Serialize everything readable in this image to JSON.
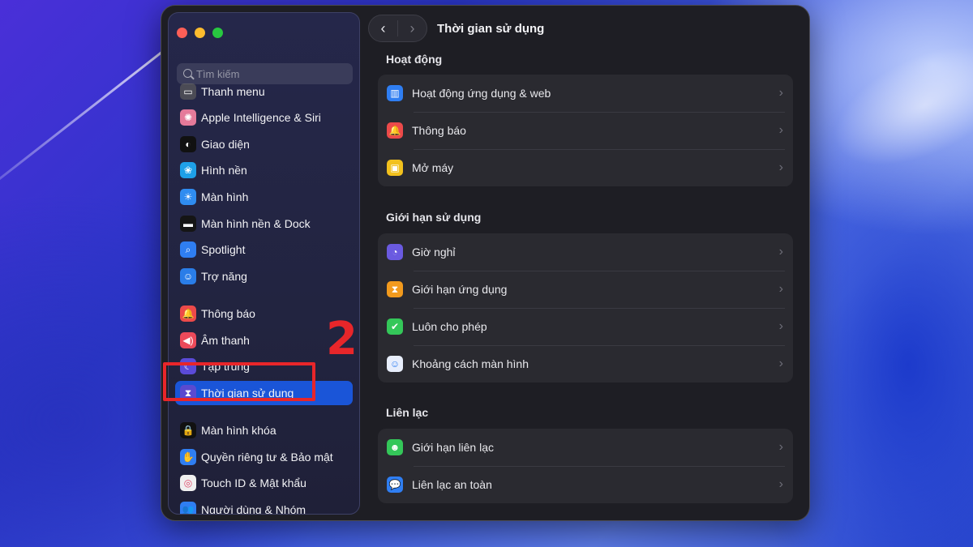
{
  "window_title": "Thời gian sử dụng",
  "search": {
    "placeholder": "Tìm kiếm"
  },
  "sidebar": {
    "items": [
      {
        "label": "Thanh menu",
        "icon": "menubar-icon",
        "color": "#4b4b55",
        "glyph": "▭"
      },
      {
        "label": "Apple Intelligence & Siri",
        "icon": "apple-intelligence-icon",
        "color": "#e57a9a",
        "glyph": "✺"
      },
      {
        "label": "Giao diện",
        "icon": "appearance-icon",
        "color": "#111111",
        "glyph": "◐"
      },
      {
        "label": "Hình nền",
        "icon": "wallpaper-icon",
        "color": "#1ea0e8",
        "glyph": "❀"
      },
      {
        "label": "Màn hình",
        "icon": "display-icon",
        "color": "#2f8cf0",
        "glyph": "☀"
      },
      {
        "label": "Màn hình nền & Dock",
        "icon": "desktop-dock-icon",
        "color": "#151515",
        "glyph": "▬"
      },
      {
        "label": "Spotlight",
        "icon": "spotlight-icon",
        "color": "#2f7ef2",
        "glyph": "⌕"
      },
      {
        "label": "Trợ năng",
        "icon": "accessibility-icon",
        "color": "#2a7de8",
        "glyph": "☺"
      },
      {
        "label": "Thông báo",
        "icon": "notifications-icon",
        "color": "#ec4a4a",
        "glyph": "🔔"
      },
      {
        "label": "Âm thanh",
        "icon": "sound-icon",
        "color": "#ec4a5a",
        "glyph": "◀)"
      },
      {
        "label": "Tập trung",
        "icon": "focus-icon",
        "color": "#5b4ad8",
        "glyph": "☾"
      },
      {
        "label": "Thời gian sử dụng",
        "icon": "screen-time-icon",
        "color": "#5a4ad0",
        "glyph": "⧗",
        "active": true
      },
      {
        "label": "Màn hình khóa",
        "icon": "lock-screen-icon",
        "color": "#111111",
        "glyph": "🔒"
      },
      {
        "label": "Quyền riêng tư & Bảo mật",
        "icon": "privacy-hand-icon",
        "color": "#2f7ef2",
        "glyph": "✋"
      },
      {
        "label": "Touch ID & Mật khẩu",
        "icon": "touch-id-icon",
        "color": "#f0f0f0",
        "glyph": "◎"
      },
      {
        "label": "Người dùng & Nhóm",
        "icon": "users-groups-icon",
        "color": "#2f7ef2",
        "glyph": "👥"
      }
    ]
  },
  "annotation": {
    "step": "2",
    "color": "#e8262a"
  },
  "sections": [
    {
      "title": "Hoạt động",
      "rows": [
        {
          "label": "Hoạt động ứng dụng & web",
          "icon": "app-activity-icon",
          "color": "#2f7ef2",
          "glyph": "▥"
        },
        {
          "label": "Thông báo",
          "icon": "notification-bell-icon",
          "color": "#ec4a4a",
          "glyph": "🔔"
        },
        {
          "label": "Mở máy",
          "icon": "pickups-icon",
          "color": "#f2c11d",
          "glyph": "▣"
        }
      ]
    },
    {
      "title": "Giới hạn sử dụng",
      "rows": [
        {
          "label": "Giờ nghỉ",
          "icon": "downtime-icon",
          "color": "#6a5ae0",
          "glyph": "◔"
        },
        {
          "label": "Giới hạn ứng dụng",
          "icon": "app-limits-icon",
          "color": "#f29a1d",
          "glyph": "⧗"
        },
        {
          "label": "Luôn cho phép",
          "icon": "always-allowed-icon",
          "color": "#34c759",
          "glyph": "✔"
        },
        {
          "label": "Khoảng cách màn hình",
          "icon": "screen-distance-icon",
          "color": "#e8eefc",
          "glyph": "☺"
        }
      ]
    },
    {
      "title": "Liên lạc",
      "rows": [
        {
          "label": "Giới hạn liên lạc",
          "icon": "communication-limits-icon",
          "color": "#34c759",
          "glyph": "☻"
        },
        {
          "label": "Liên lạc an toàn",
          "icon": "communication-safety-icon",
          "color": "#2f7ef2",
          "glyph": "💬"
        }
      ]
    }
  ]
}
